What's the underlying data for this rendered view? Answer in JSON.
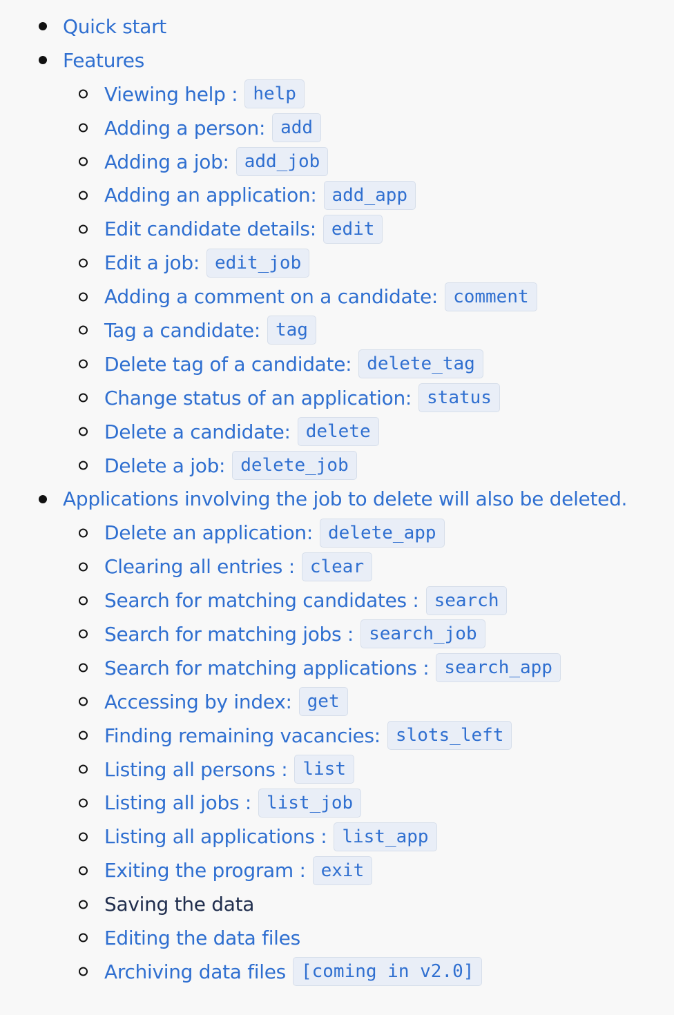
{
  "toc": [
    {
      "level": 1,
      "text": "Quick start",
      "code": null,
      "link": true
    },
    {
      "level": 1,
      "text": "Features",
      "code": null,
      "link": true
    },
    {
      "level": 2,
      "text": "Viewing help :",
      "code": "help",
      "link": true
    },
    {
      "level": 2,
      "text": "Adding a person:",
      "code": "add",
      "link": true
    },
    {
      "level": 2,
      "text": "Adding a job:",
      "code": "add_job",
      "link": true
    },
    {
      "level": 2,
      "text": "Adding an application:",
      "code": "add_app",
      "link": true
    },
    {
      "level": 2,
      "text": "Edit candidate details:",
      "code": "edit",
      "link": true
    },
    {
      "level": 2,
      "text": "Edit a job:",
      "code": "edit_job",
      "link": true
    },
    {
      "level": 2,
      "text": "Adding a comment on a candidate:",
      "code": "comment",
      "link": true
    },
    {
      "level": 2,
      "text": "Tag a candidate:",
      "code": "tag",
      "link": true
    },
    {
      "level": 2,
      "text": "Delete tag of a candidate:",
      "code": "delete_tag",
      "link": true
    },
    {
      "level": 2,
      "text": "Change status of an application:",
      "code": "status",
      "link": true
    },
    {
      "level": 2,
      "text": "Delete a candidate:",
      "code": "delete",
      "link": true
    },
    {
      "level": 2,
      "text": "Delete a job:",
      "code": "delete_job",
      "link": true
    },
    {
      "level": 1,
      "text": "Applications involving the job to delete will also be deleted.",
      "code": null,
      "link": true
    },
    {
      "level": 2,
      "text": "Delete an application:",
      "code": "delete_app",
      "link": true
    },
    {
      "level": 2,
      "text": "Clearing all entries :",
      "code": "clear",
      "link": true
    },
    {
      "level": 2,
      "text": "Search for matching candidates :",
      "code": "search",
      "link": true
    },
    {
      "level": 2,
      "text": "Search for matching jobs :",
      "code": "search_job",
      "link": true
    },
    {
      "level": 2,
      "text": "Search for matching applications :",
      "code": "search_app",
      "link": true
    },
    {
      "level": 2,
      "text": "Accessing by index:",
      "code": "get",
      "link": true
    },
    {
      "level": 2,
      "text": "Finding remaining vacancies:",
      "code": "slots_left",
      "link": true
    },
    {
      "level": 2,
      "text": "Listing all persons :",
      "code": "list",
      "link": true
    },
    {
      "level": 2,
      "text": "Listing all jobs :",
      "code": "list_job",
      "link": true
    },
    {
      "level": 2,
      "text": "Listing all applications :",
      "code": "list_app",
      "link": true
    },
    {
      "level": 2,
      "text": "Exiting the program :",
      "code": "exit",
      "link": true
    },
    {
      "level": 2,
      "text": "Saving the data",
      "code": null,
      "link": false
    },
    {
      "level": 2,
      "text": "Editing the data files",
      "code": null,
      "link": true
    },
    {
      "level": 2,
      "text": "Archiving data files",
      "code": "[coming in v2.0]",
      "link": true
    }
  ]
}
